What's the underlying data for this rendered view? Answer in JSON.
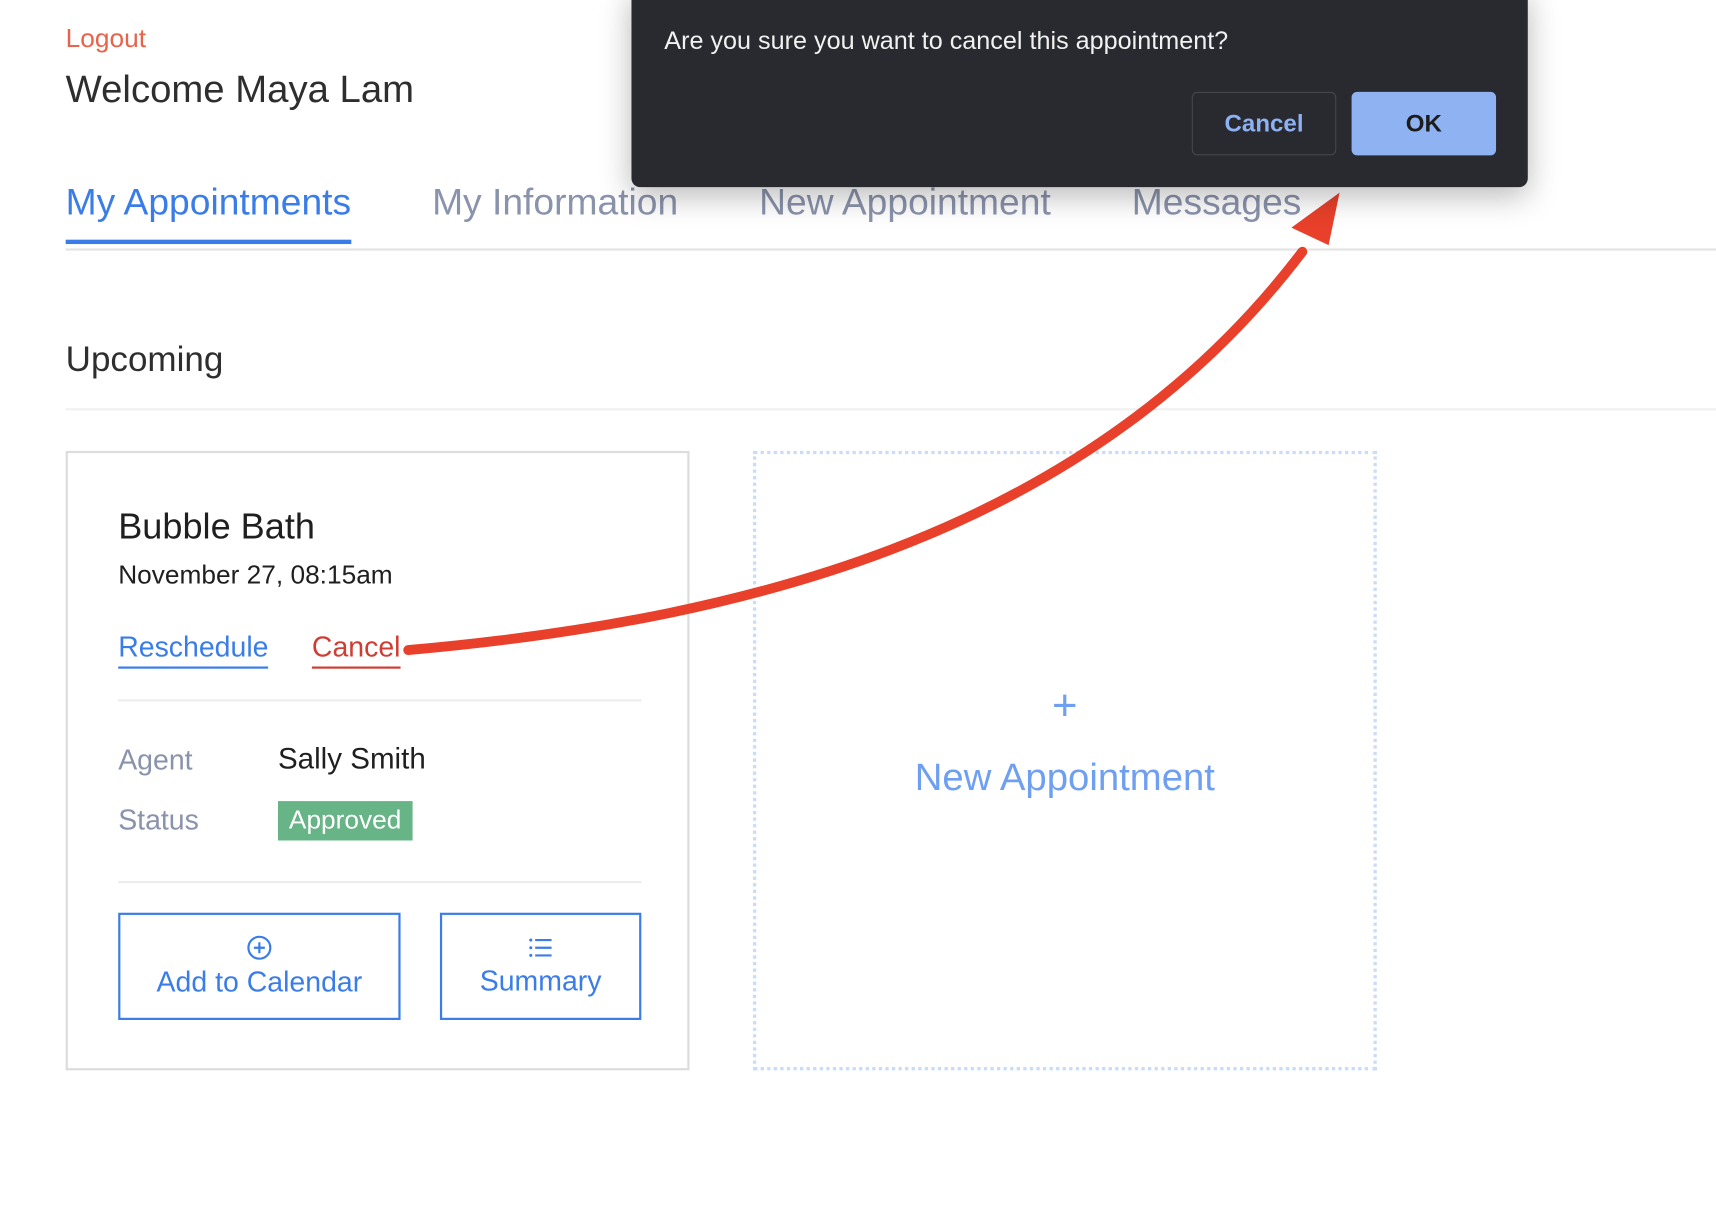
{
  "header": {
    "logout_label": "Logout",
    "welcome_text": "Welcome Maya Lam"
  },
  "tabs": [
    {
      "label": "My Appointments",
      "active": true
    },
    {
      "label": "My Information",
      "active": false
    },
    {
      "label": "New Appointment",
      "active": false
    },
    {
      "label": "Messages",
      "active": false
    }
  ],
  "section": {
    "title": "Upcoming"
  },
  "appointment_card": {
    "title": "Bubble Bath",
    "datetime": "November 27, 08:15am",
    "reschedule_label": "Reschedule",
    "cancel_label": "Cancel",
    "agent_label": "Agent",
    "agent_value": "Sally Smith",
    "status_label": "Status",
    "status_value": "Approved",
    "add_to_calendar_label": "Add to Calendar",
    "add_to_calendar_icon": "plus-circle-icon",
    "summary_label": "Summary",
    "summary_icon": "list-icon"
  },
  "new_appointment_tile": {
    "icon": "plus-icon",
    "plus_glyph": "+",
    "label": "New Appointment"
  },
  "confirm_dialog": {
    "message": "Are you sure you want to cancel this appointment?",
    "cancel_label": "Cancel",
    "ok_label": "OK"
  },
  "annotation": {
    "type": "arrow",
    "from": "card-cancel-link",
    "to": "dialog-ok-button"
  },
  "colors": {
    "accent": "#3a7de8",
    "danger": "#cf3d33",
    "logout": "#e8634a",
    "status_approved": "#67b487",
    "dialog_bg": "#292a2f",
    "ok_button": "#8fb3f2",
    "annotation_arrow": "#e8402a"
  }
}
